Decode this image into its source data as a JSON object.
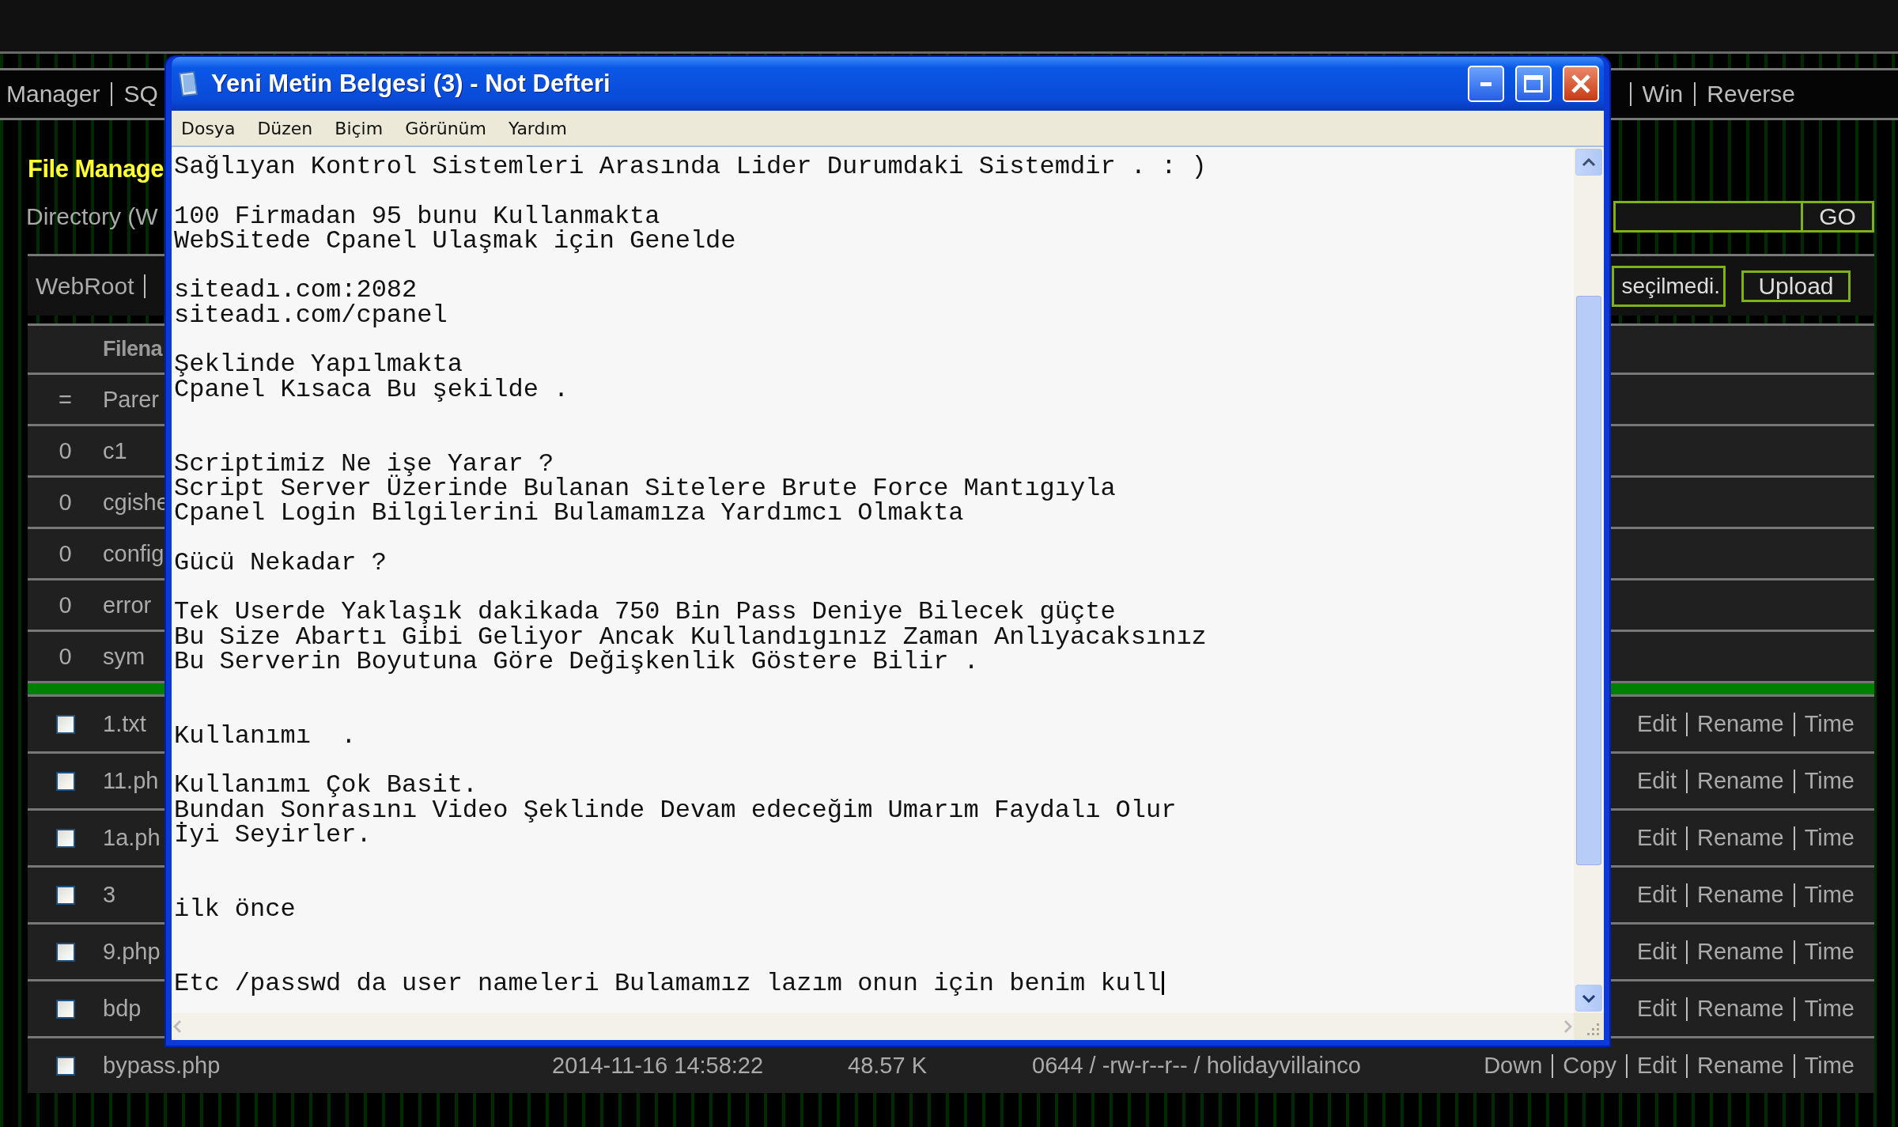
{
  "nav": {
    "left": [
      "Manager",
      "SQ"
    ],
    "right": [
      "Win",
      "Reverse"
    ]
  },
  "heading": "File Manage",
  "directory": {
    "label": "Directory (W",
    "button": "GO"
  },
  "upload": {
    "root": "WebRoot",
    "file_status": "seçilmedi.",
    "button": "Upload"
  },
  "table": {
    "header": "Filena",
    "rows": [
      {
        "kind": "parent",
        "marker": "=",
        "name": "Parer"
      },
      {
        "kind": "dir",
        "count": "0",
        "name": "c1"
      },
      {
        "kind": "dir",
        "count": "0",
        "name": "cgishe"
      },
      {
        "kind": "dir",
        "count": "0",
        "name": "config"
      },
      {
        "kind": "dir",
        "count": "0",
        "name": "error"
      },
      {
        "kind": "dir",
        "count": "0",
        "name": "sym"
      },
      {
        "kind": "divider"
      },
      {
        "kind": "file",
        "checked": false,
        "name": "1.txt",
        "actions": [
          "Edit",
          "Rename",
          "Time"
        ]
      },
      {
        "kind": "file",
        "checked": false,
        "name": "11.ph",
        "actions": [
          "Edit",
          "Rename",
          "Time"
        ]
      },
      {
        "kind": "file",
        "checked": false,
        "name": "1a.ph",
        "actions": [
          "Edit",
          "Rename",
          "Time"
        ]
      },
      {
        "kind": "file",
        "checked": false,
        "name": "3",
        "actions": [
          "Edit",
          "Rename",
          "Time"
        ]
      },
      {
        "kind": "file",
        "checked": false,
        "name": "9.php",
        "actions": [
          "Edit",
          "Rename",
          "Time"
        ]
      },
      {
        "kind": "file",
        "checked": false,
        "name": "bdp",
        "actions": [
          "Edit",
          "Rename",
          "Time"
        ]
      },
      {
        "kind": "file",
        "checked": false,
        "name": "bypass.php",
        "date": "2014-11-16 14:58:22",
        "size": "48.57 K",
        "perms": "0644 / -rw-r--r-- / holidayvillainco",
        "actions": [
          "Down",
          "Copy",
          "Edit",
          "Rename",
          "Time"
        ]
      }
    ]
  },
  "notepad": {
    "title": "Yeni Metin Belgesi (3) - Not Defteri",
    "menu": [
      "Dosya",
      "Düzen",
      "Biçim",
      "Görünüm",
      "Yardım"
    ],
    "text": "Sağlıyan Kontrol Sistemleri Arasında Lider Durumdaki Sistemdir . : )\n\n100 Firmadan 95 bunu Kullanmakta\nWebSitede Cpanel Ulaşmak için Genelde\n\nsiteadı.com:2082\nsiteadı.com/cpanel\n\nŞeklinde Yapılmakta\nCpanel Kısaca Bu şekilde .\n\n\nScriptimiz Ne işe Yarar ?\nScript Server Üzerinde Bulanan Sitelere Brute Force Mantıgıyla\nCpanel Login Bilgilerini Bulamamıza Yardımcı Olmakta\n\nGücü Nekadar ?\n\nTek Userde Yaklaşık dakikada 750 Bin Pass Deniye Bilecek güçte\nBu Size Abartı Gibi Geliyor Ancak Kullandıgınız Zaman Anlıyacaksınız\nBu Serverin Boyutuna Göre Değişkenlik Göstere Bilir .\n\n\nKullanımı  .\n\nKullanımı Çok Basit.\nBundan Sonrasını Video Şeklinde Devam edeceğim Umarım Faydalı Olur\nİyi Seyirler.\n\n\nilk önce\n\n\nEtc /passwd da user nameleri Bulamamız lazım onun için benim kull"
  }
}
